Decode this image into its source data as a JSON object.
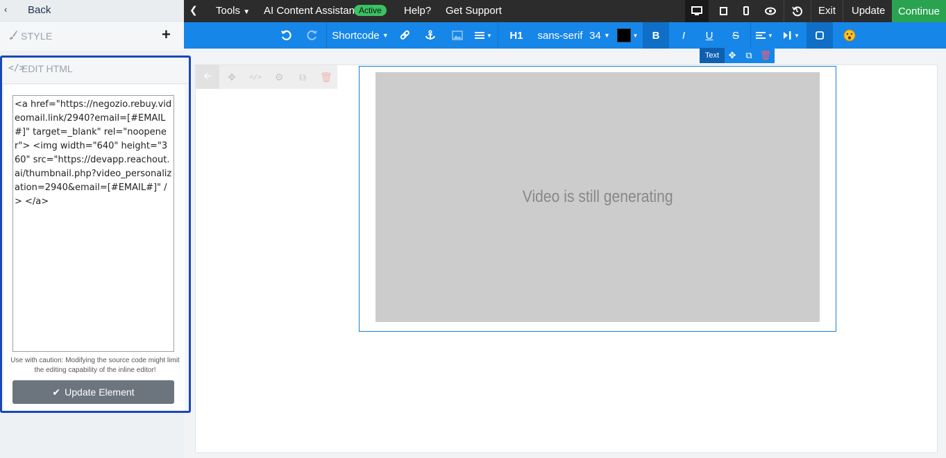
{
  "sidebar": {
    "back_label": "Back",
    "style_label": "STYLE",
    "edit_title": "EDIT HTML",
    "html_source": "<a href=\"https://negozio.rebuy.videomail.link/2940?email=[#EMAIL#]\" target=_blank\" rel=\"noopener\"> <img width=\"640\" height=\"360\" src=\"https://devapp.reachout.ai/thumbnail.php?video_personalization=2940&email=[#EMAIL#]\" /> </a>",
    "caution": "Use with caution: Modifying the source code might limit the editing capability of the inline editor!",
    "update_button": "Update Element"
  },
  "topbar": {
    "tools": "Tools",
    "ai_assistant": "AI Content Assistant",
    "ai_status": "Active",
    "help": "Help?",
    "support": "Get Support",
    "exit": "Exit",
    "update": "Update",
    "continue": "Continue"
  },
  "formatbar": {
    "shortcode": "Shortcode",
    "heading": "H1",
    "font": "sans-serif",
    "size": "34",
    "bold": "B",
    "italic": "I",
    "underline": "U",
    "strike": "S"
  },
  "canvas": {
    "text_tag": "Text",
    "video_message": "Video is still generating"
  },
  "colors": {
    "accent_blue": "#1686e8",
    "continue_green": "#2aa351",
    "active_badge": "#3ac162",
    "selection_border": "#1a47b8"
  }
}
